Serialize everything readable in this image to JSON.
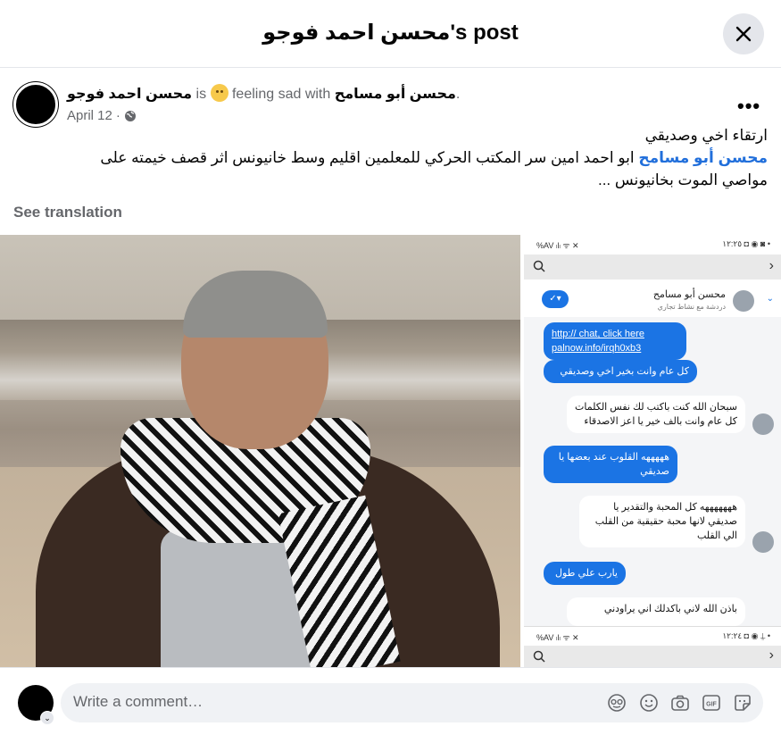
{
  "dialog": {
    "title": "محسن احمد فوجو's post"
  },
  "post": {
    "author": "محسن احمد فوجو",
    "is_text": "is",
    "feeling": "feeling sad with",
    "tagged": "محسن أبو مسامح",
    "period": ".",
    "date": "April 12",
    "separator": "·",
    "text_line1": "ارتقاء  اخي وصديقي",
    "mention": "محسن أبو مسامح",
    "text_line2_rest": "ابو احمد امين سر المكتب الحركي للمعلمين اقليم وسط خانيونس اثر قصف خيمته على مواصي الموت بخانيونس ...",
    "see_translation": "See translation"
  },
  "screenshot": {
    "status_left": "‎%AV ‎ₗ‎lₗ ‎ᯤ ✕",
    "status_right": "١٢:٢٥ ◘ ◉ ◙ •",
    "contact_name": "محسن أبو مسامح",
    "contact_sub": "دردشة مع نشاط تجاري",
    "messages": [
      {
        "dir": "out",
        "text": "http:// chat, click here\npalnow.info/irqh0xb3"
      },
      {
        "dir": "out",
        "text": "كل عام وانت بخير اخي وصديقي"
      },
      {
        "dir": "in",
        "text": "سبحان الله كنت باكتب لك نفس الكلمات كل عام وانت بالف خير يا اعز الاصدقاء"
      },
      {
        "dir": "out",
        "text": "هههههه القلوب عند بعضها يا صديقي"
      },
      {
        "dir": "in",
        "text": "هههههههه كل المحبة والتقدير يا صديقي لانها محبة حقيقية من القلب الي القلب"
      },
      {
        "dir": "out",
        "text": "يارب علي طول"
      },
      {
        "dir": "in",
        "text": "باذن الله لاني باكدلك اني يراودني"
      }
    ],
    "status2_right": "١٢:٢٤ ◘ ◉ ⍊ •"
  },
  "comment": {
    "placeholder": "Write a comment…"
  },
  "icons": {
    "close": "close-icon",
    "more": "more-options-icon",
    "globe": "globe-icon",
    "avatar_sticker": "avatar-sticker-icon",
    "emoji": "emoji-icon",
    "camera": "camera-icon",
    "gif": "gif-icon",
    "sticker": "sticker-icon"
  },
  "colors": {
    "mention_blue": "#216fdb",
    "bubble_blue": "#1b74e4",
    "muted_text": "#65676b"
  }
}
